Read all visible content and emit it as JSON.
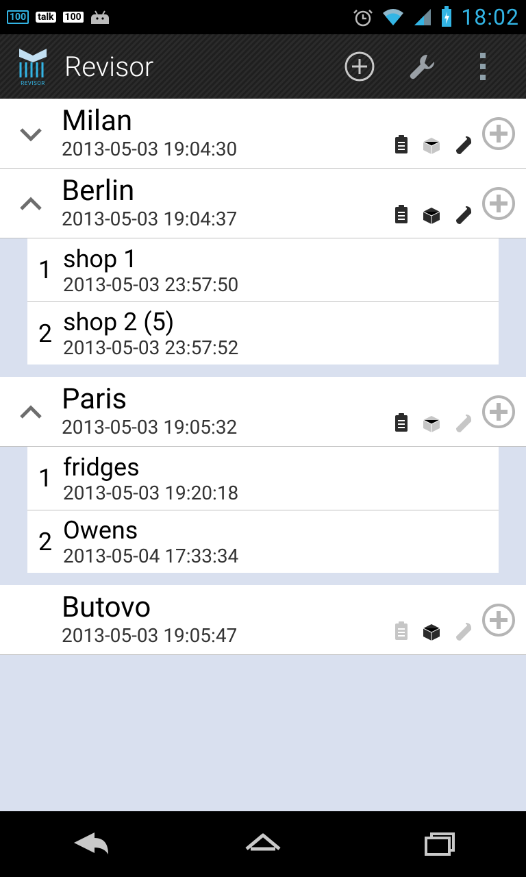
{
  "status": {
    "time": "18:02"
  },
  "app": {
    "title": "Revisor",
    "icon_label": "REVISOR"
  },
  "groups": [
    {
      "name": "Milan",
      "timestamp": "2013-05-03 19:04:30",
      "expanded": false,
      "has_children": true,
      "icons": {
        "clipboard": "active",
        "box": "inactive",
        "scanner": "active"
      },
      "children": []
    },
    {
      "name": "Berlin",
      "timestamp": "2013-05-03 19:04:37",
      "expanded": true,
      "has_children": true,
      "icons": {
        "clipboard": "active",
        "box": "active",
        "scanner": "active"
      },
      "children": [
        {
          "index": "1",
          "name": "shop 1",
          "timestamp": "2013-05-03 23:57:50"
        },
        {
          "index": "2",
          "name": "shop 2 (5)",
          "timestamp": "2013-05-03 23:57:52"
        }
      ]
    },
    {
      "name": "Paris",
      "timestamp": "2013-05-03 19:05:32",
      "expanded": true,
      "has_children": true,
      "icons": {
        "clipboard": "active",
        "box": "inactive",
        "scanner": "inactive"
      },
      "children": [
        {
          "index": "1",
          "name": "fridges",
          "timestamp": "2013-05-03 19:20:18"
        },
        {
          "index": "2",
          "name": "Owens",
          "timestamp": "2013-05-04 17:33:34"
        }
      ]
    },
    {
      "name": "Butovo",
      "timestamp": "2013-05-03 19:05:47",
      "expanded": false,
      "has_children": false,
      "icons": {
        "clipboard": "inactive",
        "box": "active",
        "scanner": "inactive"
      },
      "children": []
    }
  ]
}
